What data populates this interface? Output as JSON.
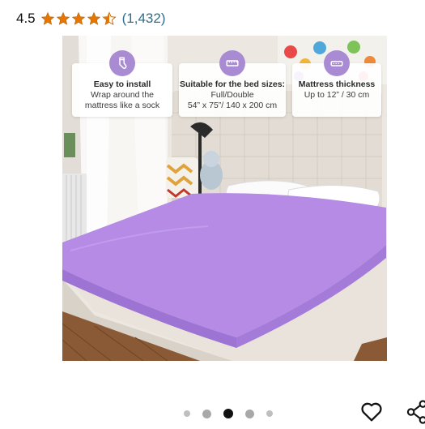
{
  "rating": {
    "value": "4.5",
    "count": "(1,432)",
    "stars": 4.5,
    "star_color": "#e77600"
  },
  "features": [
    {
      "icon": "sock-icon",
      "title": "Easy to install",
      "desc_lines": [
        "Wrap around the",
        "mattress like a sock"
      ]
    },
    {
      "icon": "ruler-icon",
      "title": "Suitable for the bed sizes:",
      "desc_lines": [
        "Full/Double",
        "54” x 75”/ 140 x 200 cm"
      ]
    },
    {
      "icon": "mattress-icon",
      "title": "Mattress thickness",
      "desc_lines": [
        "Up to 12” / 30 cm"
      ]
    }
  ],
  "carousel": {
    "total": 5,
    "active_index": 2
  },
  "colors": {
    "sheet": "#b58be6",
    "icon_badge": "#a98bd3",
    "link": "#2f6d8a"
  },
  "actions": {
    "favorite_icon": "heart-icon",
    "share_icon": "share-icon"
  }
}
